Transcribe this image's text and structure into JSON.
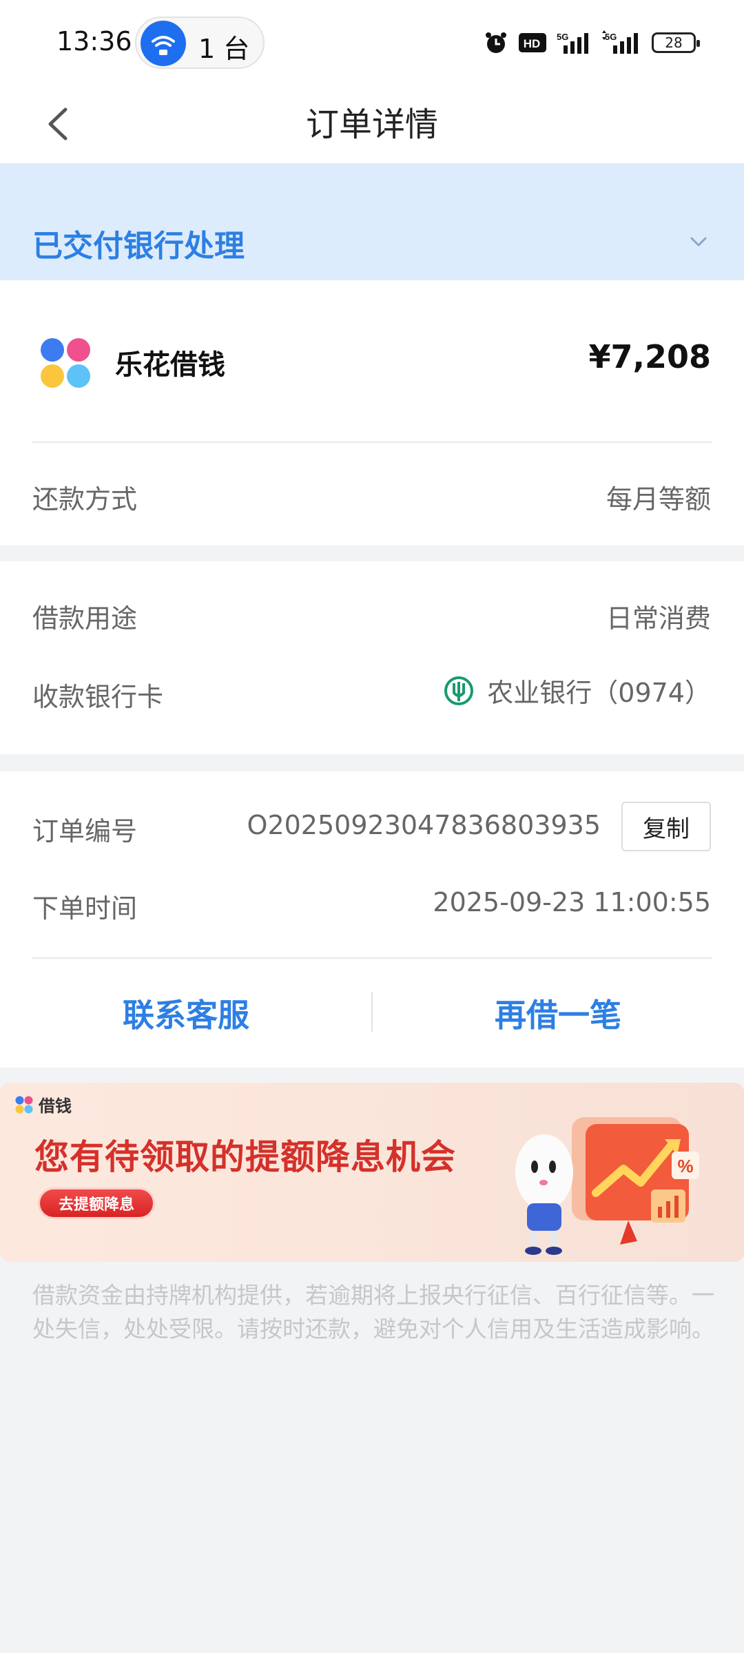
{
  "status_bar": {
    "time": "13:36",
    "device_count": "1 台",
    "battery": "28",
    "icons": [
      "alarm-icon",
      "hd-icon",
      "5g-signal-icon",
      "5g-signal-icon",
      "battery-icon"
    ]
  },
  "header": {
    "title": "订单详情",
    "back_icon": "chevron-left-icon"
  },
  "banner": {
    "status": "已交付银行处理",
    "expand_icon": "chevron-down-icon"
  },
  "loan": {
    "product_name": "乐花借钱",
    "amount": "¥7,208",
    "repayment_label": "还款方式",
    "repayment_value": "每月等额"
  },
  "details": {
    "purpose_label": "借款用途",
    "purpose_value": "日常消费",
    "card_label": "收款银行卡",
    "card_value": "农业银行（0974）"
  },
  "order": {
    "id_label": "订单编号",
    "id_value": "O20250923047836803935",
    "copy_label": "复制",
    "time_label": "下单时间",
    "time_value": "2025-09-23 11:00:55"
  },
  "actions": {
    "contact_label": "联系客服",
    "borrow_again_label": "再借一笔"
  },
  "promo": {
    "tag": "借钱",
    "title": "您有待领取的提额降息机会",
    "button": "去提额降息"
  },
  "disclaimer": "借款资金由持牌机构提供，若逾期将上报央行征信、百行征信等。一处失信，处处受限。请按时还款，避免对个人信用及生活造成影响。",
  "colors": {
    "accent": "#2d7fe3",
    "banner_bg": "#ddecfc",
    "promo_red": "#d4312a"
  }
}
